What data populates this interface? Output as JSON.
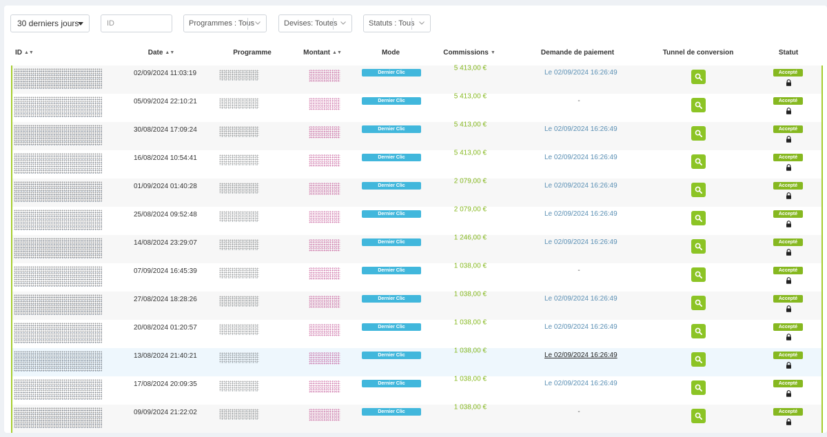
{
  "filters": {
    "period": "30 derniers jours",
    "id_placeholder": "ID",
    "programmes": "Programmes : Tous",
    "devises": "Devises: Toutes",
    "statuts": "Statuts : Tous"
  },
  "columns": {
    "id": "ID",
    "date": "Date",
    "programme": "Programme",
    "montant": "Montant",
    "mode": "Mode",
    "commissions": "Commissions",
    "paiement": "Demande de paiement",
    "tunnel": "Tunnel de conversion",
    "statut": "Statut"
  },
  "rows": [
    {
      "date": "02/09/2024 11:03:19",
      "mode": "Dernier Clic",
      "commission": "5 413,00 €",
      "paiement": "Le 02/09/2024 16:26:49",
      "statut": "Accepté"
    },
    {
      "date": "05/09/2024 22:10:21",
      "mode": "Dernier Clic",
      "commission": "5 413,00 €",
      "paiement": "-",
      "statut": "Accepté"
    },
    {
      "date": "30/08/2024 17:09:24",
      "mode": "Dernier Clic",
      "commission": "5 413,00 €",
      "paiement": "Le 02/09/2024 16:26:49",
      "statut": "Accepté"
    },
    {
      "date": "16/08/2024 10:54:41",
      "mode": "Dernier Clic",
      "commission": "5 413,00 €",
      "paiement": "Le 02/09/2024 16:26:49",
      "statut": "Accepté"
    },
    {
      "date": "01/09/2024 01:40:28",
      "mode": "Dernier Clic",
      "commission": "2 079,00 €",
      "paiement": "Le 02/09/2024 16:26:49",
      "statut": "Accepté"
    },
    {
      "date": "25/08/2024 09:52:48",
      "mode": "Dernier Clic",
      "commission": "2 079,00 €",
      "paiement": "Le 02/09/2024 16:26:49",
      "statut": "Accepté"
    },
    {
      "date": "14/08/2024 23:29:07",
      "mode": "Dernier Clic",
      "commission": "1 246,00 €",
      "paiement": "Le 02/09/2024 16:26:49",
      "statut": "Accepté"
    },
    {
      "date": "07/09/2024 16:45:39",
      "mode": "Dernier Clic",
      "commission": "1 038,00 €",
      "paiement": "-",
      "statut": "Accepté"
    },
    {
      "date": "27/08/2024 18:28:26",
      "mode": "Dernier Clic",
      "commission": "1 038,00 €",
      "paiement": "Le 02/09/2024 16:26:49",
      "statut": "Accepté"
    },
    {
      "date": "20/08/2024 01:20:57",
      "mode": "Dernier Clic",
      "commission": "1 038,00 €",
      "paiement": "Le 02/09/2024 16:26:49",
      "statut": "Accepté"
    },
    {
      "date": "13/08/2024 21:40:21",
      "mode": "Dernier Clic",
      "commission": "1 038,00 €",
      "paiement": "Le 02/09/2024 16:26:49",
      "statut": "Accepté"
    },
    {
      "date": "17/08/2024 20:09:35",
      "mode": "Dernier Clic",
      "commission": "1 038,00 €",
      "paiement": "Le 02/09/2024 16:26:49",
      "statut": "Accepté"
    },
    {
      "date": "09/09/2024 21:22:02",
      "mode": "Dernier Clic",
      "commission": "1 038,00 €",
      "paiement": "-",
      "statut": "Accepté"
    }
  ],
  "colors": {
    "accent_green": "#86b820",
    "mode_blue": "#41b7dc",
    "link_blue": "#5a8fb4"
  },
  "icons": {
    "tunnel": "search-icon",
    "status": "lock-icon",
    "sort": "sort-icon"
  }
}
